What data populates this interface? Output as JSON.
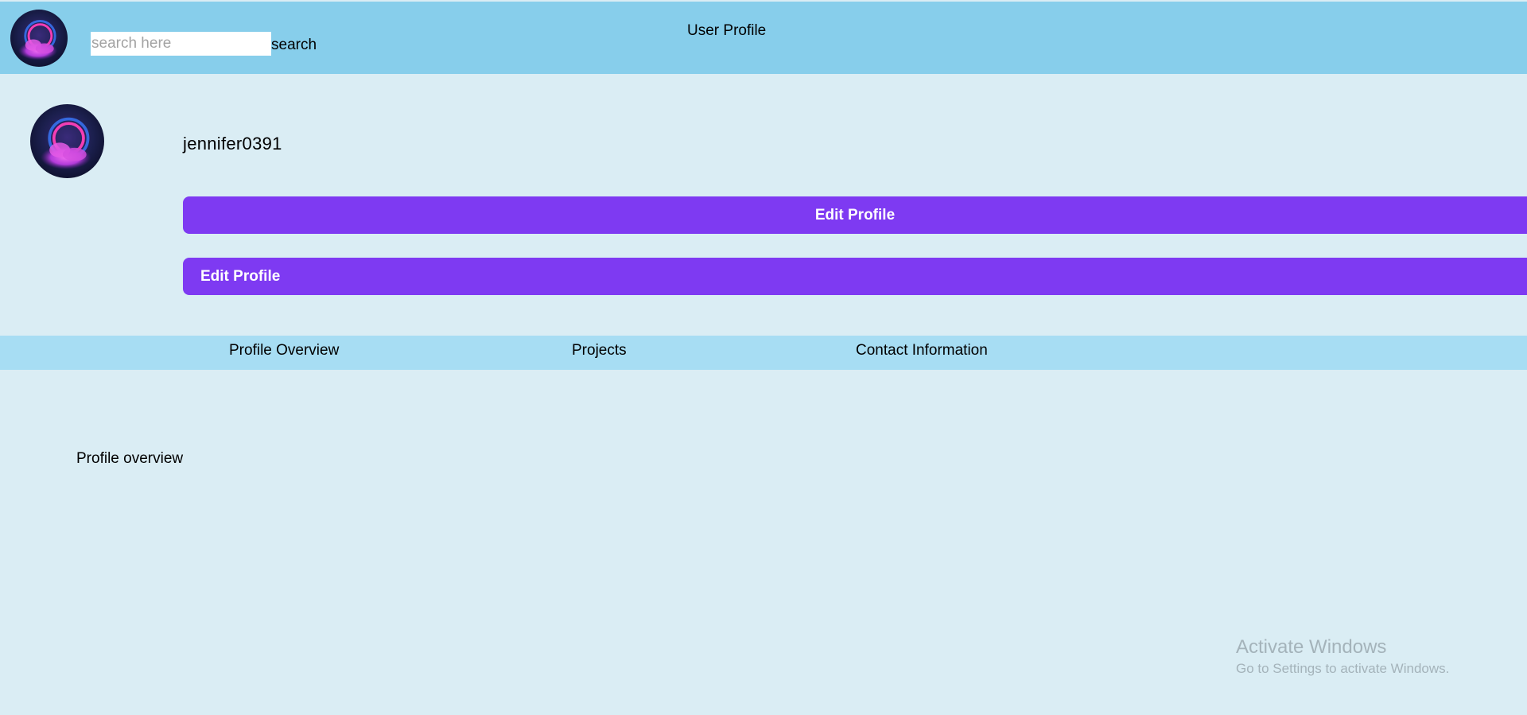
{
  "header": {
    "avatar_icon": "profile-avatar-image",
    "search": {
      "placeholder": "search here",
      "value": "",
      "button_label": "search"
    },
    "title": "User Profile"
  },
  "profile": {
    "avatar_icon": "profile-avatar-image",
    "username": "jennifer0391",
    "edit_button_1": "Edit Profile",
    "edit_button_2": "Edit Profile"
  },
  "tabs": [
    {
      "label": "Profile Overview"
    },
    {
      "label": "Projects"
    },
    {
      "label": "Contact Information"
    }
  ],
  "content": {
    "section_text": "Profile overview"
  },
  "watermark": {
    "title": "Activate Windows",
    "subtitle": "Go to Settings to activate Windows."
  },
  "colors": {
    "header_bg": "#87ceeb",
    "page_bg": "#daedf4",
    "tabs_bg": "#a7ddf3",
    "button_bg": "#7e3af2",
    "button_text": "#ffffff"
  }
}
